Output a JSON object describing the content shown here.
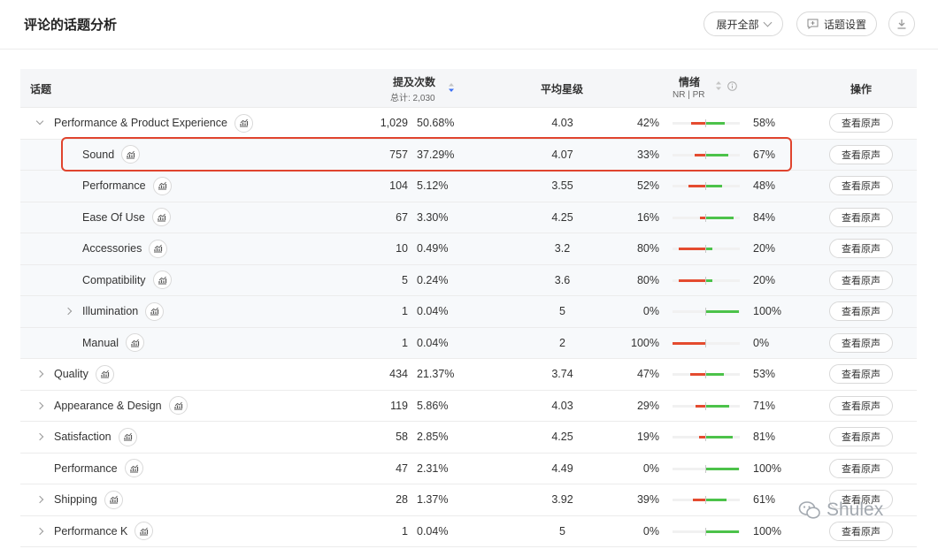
{
  "header": {
    "title": "评论的话题分析",
    "expand_all": "展开全部",
    "topic_settings": "话题设置"
  },
  "columns": {
    "topic": "话题",
    "mentions": "提及次数",
    "total": "总计: 2,030",
    "avg_rating": "平均星级",
    "sentiment": "情绪",
    "sentiment_sub": "NR | PR",
    "action": "操作"
  },
  "rows": [
    {
      "name": "Performance & Product Experience",
      "level": 0,
      "caret": "down",
      "count": "1,029",
      "pct": "50.68%",
      "rating": "4.03",
      "neg": "42%",
      "pos": "58%",
      "neg_frac": 0.42,
      "pos_frac": 0.58,
      "action": "查看原声"
    },
    {
      "name": "Sound",
      "level": 1,
      "caret": "",
      "count": "757",
      "pct": "37.29%",
      "rating": "4.07",
      "neg": "33%",
      "pos": "67%",
      "neg_frac": 0.33,
      "pos_frac": 0.67,
      "action": "查看原声"
    },
    {
      "name": "Performance",
      "level": 1,
      "caret": "",
      "count": "104",
      "pct": "5.12%",
      "rating": "3.55",
      "neg": "52%",
      "pos": "48%",
      "neg_frac": 0.52,
      "pos_frac": 0.48,
      "action": "查看原声"
    },
    {
      "name": "Ease Of Use",
      "level": 1,
      "caret": "",
      "count": "67",
      "pct": "3.30%",
      "rating": "4.25",
      "neg": "16%",
      "pos": "84%",
      "neg_frac": 0.16,
      "pos_frac": 0.84,
      "action": "查看原声"
    },
    {
      "name": "Accessories",
      "level": 1,
      "caret": "",
      "count": "10",
      "pct": "0.49%",
      "rating": "3.2",
      "neg": "80%",
      "pos": "20%",
      "neg_frac": 0.8,
      "pos_frac": 0.2,
      "action": "查看原声"
    },
    {
      "name": "Compatibility",
      "level": 1,
      "caret": "",
      "count": "5",
      "pct": "0.24%",
      "rating": "3.6",
      "neg": "80%",
      "pos": "20%",
      "neg_frac": 0.8,
      "pos_frac": 0.2,
      "action": "查看原声"
    },
    {
      "name": "Illumination",
      "level": 1,
      "caret": "right",
      "count": "1",
      "pct": "0.04%",
      "rating": "5",
      "neg": "0%",
      "pos": "100%",
      "neg_frac": 0.0,
      "pos_frac": 1.0,
      "action": "查看原声"
    },
    {
      "name": "Manual",
      "level": 1,
      "caret": "",
      "count": "1",
      "pct": "0.04%",
      "rating": "2",
      "neg": "100%",
      "pos": "0%",
      "neg_frac": 1.0,
      "pos_frac": 0.0,
      "action": "查看原声"
    },
    {
      "name": "Quality",
      "level": 0,
      "caret": "right",
      "count": "434",
      "pct": "21.37%",
      "rating": "3.74",
      "neg": "47%",
      "pos": "53%",
      "neg_frac": 0.47,
      "pos_frac": 0.53,
      "action": "查看原声"
    },
    {
      "name": "Appearance & Design",
      "level": 0,
      "caret": "right",
      "count": "119",
      "pct": "5.86%",
      "rating": "4.03",
      "neg": "29%",
      "pos": "71%",
      "neg_frac": 0.29,
      "pos_frac": 0.71,
      "action": "查看原声"
    },
    {
      "name": "Satisfaction",
      "level": 0,
      "caret": "right",
      "count": "58",
      "pct": "2.85%",
      "rating": "4.25",
      "neg": "19%",
      "pos": "81%",
      "neg_frac": 0.19,
      "pos_frac": 0.81,
      "action": "查看原声"
    },
    {
      "name": "Performance",
      "level": 0,
      "caret": "",
      "count": "47",
      "pct": "2.31%",
      "rating": "4.49",
      "neg": "0%",
      "pos": "100%",
      "neg_frac": 0.0,
      "pos_frac": 1.0,
      "action": "查看原声"
    },
    {
      "name": "Shipping",
      "level": 0,
      "caret": "right",
      "count": "28",
      "pct": "1.37%",
      "rating": "3.92",
      "neg": "39%",
      "pos": "61%",
      "neg_frac": 0.39,
      "pos_frac": 0.61,
      "action": "查看原声"
    },
    {
      "name": "Performance K",
      "level": 0,
      "caret": "right",
      "count": "1",
      "pct": "0.04%",
      "rating": "5",
      "neg": "0%",
      "pos": "100%",
      "neg_frac": 0.0,
      "pos_frac": 1.0,
      "action": "查看原声"
    }
  ],
  "watermark": "Shulex",
  "colors": {
    "negative": "#e44b2f",
    "positive": "#4cc24a",
    "highlight": "#e0442e",
    "sort_active": "#3b6ff5"
  }
}
